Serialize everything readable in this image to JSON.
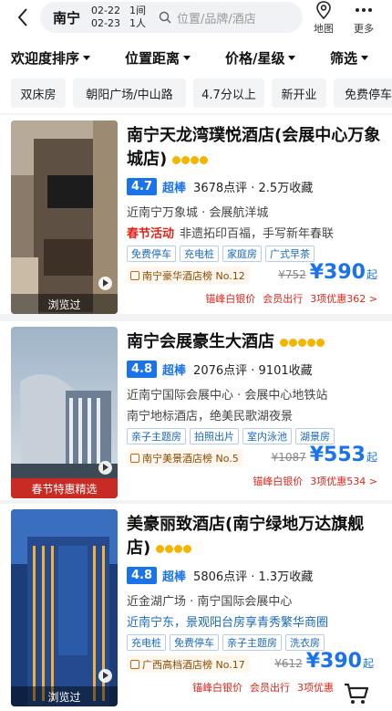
{
  "header": {
    "city": "南宁",
    "checkin": "02-22",
    "checkout": "02-23",
    "nights": "1间",
    "rooms": "1人",
    "search_placeholder": "位置/品牌/酒店",
    "map_label": "地图",
    "more_label": "更多"
  },
  "sort": {
    "popularity": "欢迎度排序",
    "distance": "位置距离",
    "price_star": "价格/星级",
    "filter": "筛选"
  },
  "chips": [
    "双床房",
    "朝阳广场/中山路",
    "4.7分以上",
    "新开业",
    "免费停车"
  ],
  "hotels": [
    {
      "name": "南宁天龙湾璞悦酒店(会展中心万象城店)",
      "stars": 4,
      "score": "4.7",
      "score_label": "超棒",
      "reviews": "3678点评 · 2.5万收藏",
      "location": "近南宁万象城 · 会展航洋城",
      "promo_label": "春节活动",
      "promo_text": "非遗拓印百福，手写新年春联",
      "tags": [
        "免费停车",
        "充电桩",
        "家庭房",
        "广式早茶"
      ],
      "rank": "南宁豪华酒店榜 No.12",
      "old_price": "¥752",
      "price": "¥390",
      "price_suffix": "起",
      "benefits": [
        "锚峰白银价",
        "会员出行",
        "3项优惠362 >"
      ],
      "thumb_label": "浏览过"
    },
    {
      "name": "南宁会展豪生大酒店",
      "stars": 5,
      "score": "4.8",
      "score_label": "超棒",
      "reviews": "2076点评 · 9101收藏",
      "location": "近南宁国际会展中心 · 会展中心地铁站",
      "promo_label": "",
      "promo_text": "南宁地标酒店，绝美民歌湖夜景",
      "tags": [
        "亲子主题房",
        "拍照出片",
        "室内泳池",
        "湖景房"
      ],
      "rank": "南宁美景酒店榜 No.5",
      "old_price": "¥1087",
      "price": "¥553",
      "price_suffix": "起",
      "benefits": [
        "锚峰白银价",
        "3项优惠534 >"
      ],
      "thumb_label": "春节特惠精选"
    },
    {
      "name": "美豪丽致酒店(南宁绿地万达旗舰店)",
      "stars": 4,
      "score": "4.8",
      "score_label": "超棒",
      "reviews": "5806点评 · 1.3万收藏",
      "location": "近金湖广场 · 南宁国际会展中心",
      "promo_label": "",
      "promo_text": "近南宁东，景观阳台房享青秀繁华商圈",
      "tags": [
        "充电桩",
        "免费停车",
        "亲子主题房",
        "洗衣房"
      ],
      "rank": "广西高档酒店榜 No.17",
      "old_price": "¥612",
      "price": "¥390",
      "price_suffix": "起",
      "benefits": [
        "锚峰白银价",
        "会员出行",
        "3项优惠"
      ],
      "thumb_label": "浏览过"
    }
  ],
  "colors": {
    "accent": "#1a73e8",
    "promo_red": "#e1251b",
    "star_gold": "#f5b400"
  }
}
